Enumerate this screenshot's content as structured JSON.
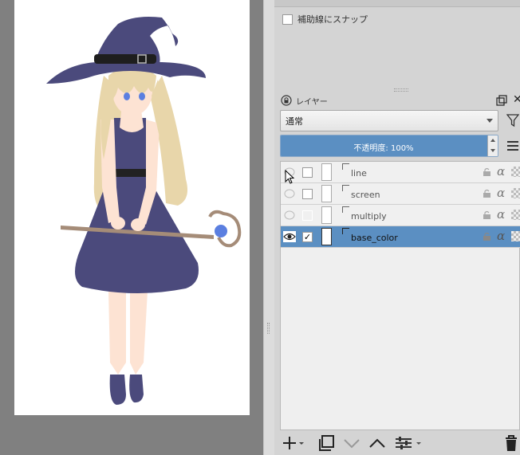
{
  "snap": {
    "label": "補助線にスナップ",
    "checked": false
  },
  "layer_panel": {
    "title": "レイヤー",
    "blend_mode": "通常",
    "opacity": {
      "label": "不透明度: 100%",
      "value": 100
    },
    "layers": [
      {
        "name": "line",
        "visible": false,
        "checked": false,
        "selected": false
      },
      {
        "name": "screen",
        "visible": false,
        "checked": false,
        "selected": false
      },
      {
        "name": "multiply",
        "visible": false,
        "checked": false,
        "selected": false
      },
      {
        "name": "base_color",
        "visible": true,
        "checked": true,
        "selected": true
      }
    ]
  },
  "colors": {
    "accent": "#5b8fc2",
    "hat_dress": "#4b4a7c",
    "hair": "#e8d6aa",
    "skin": "#fde3d3",
    "staff": "#a58c78",
    "gem": "#5b7fe0"
  },
  "icons": {
    "lock": "lock-icon",
    "float": "float-window-icon",
    "close": "close-icon",
    "filter": "filter-icon",
    "menu": "hamburger-menu-icon",
    "eye": "eye-icon",
    "alpha": "alpha-lock-icon",
    "add": "add-layer-icon",
    "duplicate": "duplicate-layer-icon",
    "merge_down": "merge-down-icon",
    "merge_up": "move-up-icon",
    "adjust": "adjust-icon",
    "delete": "trash-icon"
  }
}
